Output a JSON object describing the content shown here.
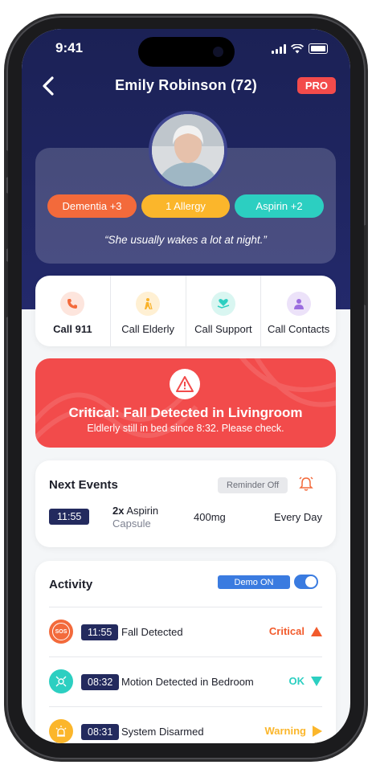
{
  "status_bar": {
    "time": "9:41"
  },
  "header": {
    "title": "Emily Robinson  (72)",
    "badge": "PRO"
  },
  "profile": {
    "tags": [
      {
        "label": "Dementia +3",
        "color": "#f36a3b"
      },
      {
        "label": "1 Allergy",
        "color": "#fbb62b"
      },
      {
        "label": "Aspirin +2",
        "color": "#2ccfc1"
      }
    ],
    "quote": "“She usually wakes a lot at night.”"
  },
  "actions": [
    {
      "label": "Call 911",
      "icon": "phone-icon",
      "color": "#fde5dd"
    },
    {
      "label": "Call Elderly",
      "icon": "elderly-icon",
      "color": "#fff0d3"
    },
    {
      "label": "Call Support",
      "icon": "heart-hand-icon",
      "color": "#d9f6f1"
    },
    {
      "label": "Call Contacts",
      "icon": "contacts-icon",
      "color": "#ece2f9"
    }
  ],
  "alert": {
    "title": "Critical: Fall Detected in Livingroom",
    "subtitle": "Eldlerly still in bed since 8:32. Please check."
  },
  "events": {
    "title": "Next Events",
    "reminder": "Reminder Off",
    "item": {
      "time": "11:55",
      "qty": "2x",
      "name": "Aspirin",
      "form": "Capsule",
      "dose": "400mg",
      "freq": "Every Day"
    }
  },
  "activity": {
    "title": "Activity",
    "demo_label": "Demo ON",
    "rows": [
      {
        "time": "11:55",
        "label": "Fall Detected",
        "status": "Critical",
        "status_color": "#f25b2c",
        "icon": "sos-icon",
        "icon_color": "#f36a3b"
      },
      {
        "time": "08:32",
        "label": "Motion Detected in Bedroom",
        "status": "OK",
        "status_color": "#2ccfc1",
        "icon": "motion-icon",
        "icon_color": "#2ccfc1"
      },
      {
        "time": "08:31",
        "label": "System Disarmed",
        "status": "Warning",
        "status_color": "#fbb62b",
        "icon": "alarm-icon",
        "icon_color": "#fbb62b"
      }
    ]
  }
}
